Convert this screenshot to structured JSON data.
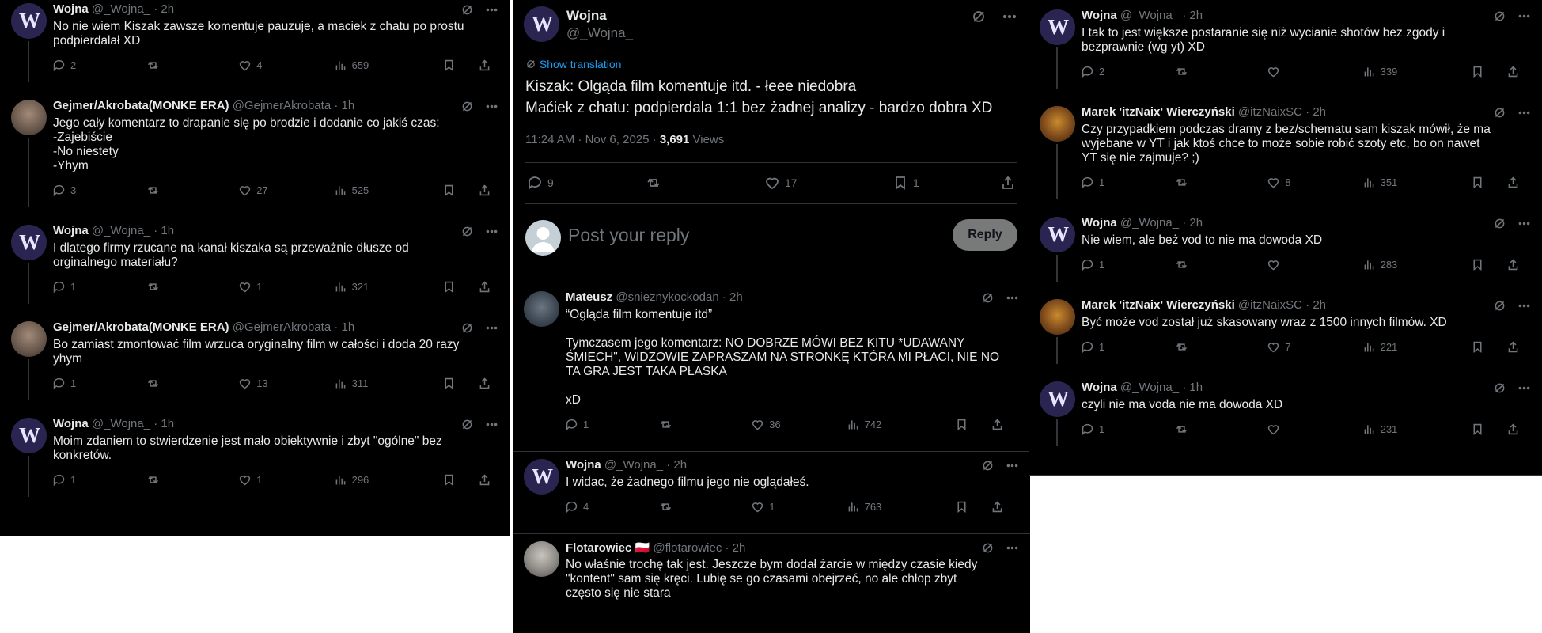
{
  "col1": {
    "tweets": [
      {
        "name": "Wojna",
        "handle": "@_Wojna_",
        "time": "2h",
        "lines": [
          "No nie wiem Kiszak zawsze komentuje pauzuje, a maciek z chatu po prostu",
          "podpierdalał XD"
        ],
        "replies": "2",
        "retweets": "",
        "likes": "4",
        "views": "659"
      },
      {
        "name": "Gejmer/Akrobata(MONKE ERA)",
        "handle": "@GejmerAkrobata",
        "time": "1h",
        "lines": [
          "Jego cały komentarz to drapanie się po brodzie i dodanie co jakiś czas:",
          "-Zajebiście",
          "-No niestety",
          "-Yhym"
        ],
        "replies": "3",
        "retweets": "",
        "likes": "27",
        "views": "525"
      },
      {
        "name": "Wojna",
        "handle": "@_Wojna_",
        "time": "1h",
        "lines": [
          "I dlatego firmy rzucane na kanał kiszaka są przeważnie dłusze od",
          "orginalnego materiału?"
        ],
        "replies": "1",
        "retweets": "",
        "likes": "1",
        "views": "321"
      },
      {
        "name": "Gejmer/Akrobata(MONKE ERA)",
        "handle": "@GejmerAkrobata",
        "time": "1h",
        "lines": [
          "Bo zamiast zmontować film wrzuca oryginalny film w całości i doda 20 razy",
          "yhym"
        ],
        "replies": "1",
        "retweets": "",
        "likes": "13",
        "views": "311"
      },
      {
        "name": "Wojna",
        "handle": "@_Wojna_",
        "time": "1h",
        "lines": [
          "Moim zdaniem to stwierdzenie jest mało obiektywnie i zbyt \"ogólne\" bez",
          "konkretów."
        ],
        "replies": "1",
        "retweets": "",
        "likes": "1",
        "views": "296"
      }
    ]
  },
  "col2": {
    "main": {
      "name": "Wojna",
      "handle": "@_Wojna_",
      "show_translation": "Show translation",
      "lines": [
        "Kiszak: Olgąda film komentuje itd. - łeee niedobra",
        "Maćiek z chatu: podpierdala 1:1 bez żadnej analizy - bardzo dobra XD"
      ],
      "timestamp": "11:24 AM · Nov 6, 2025 · ",
      "views_count": "3,691",
      "views_label": " Views",
      "replies": "9",
      "retweets": "",
      "likes": "17",
      "bookmarks": "1"
    },
    "reply_box": {
      "placeholder": "Post your reply",
      "button": "Reply"
    },
    "tweets": [
      {
        "name": "Mateusz",
        "handle": "@snieznykockodan",
        "time": "2h",
        "lines": [
          "“Ogląda film komentuje itd”",
          "",
          "Tymczasem jego komentarz: NO DOBRZE MÓWI BEZ KITU *UDAWANY",
          "ŚMIECH\", WIDZOWIE ZAPRASZAM NA STRONKĘ KTÓRA MI PŁACI, NIE NO",
          "TA GRA JEST TAKA PŁASKA",
          "",
          "xD"
        ],
        "replies": "1",
        "retweets": "",
        "likes": "36",
        "views": "742"
      },
      {
        "name": "Wojna",
        "handle": "@_Wojna_",
        "time": "2h",
        "lines": [
          "I widac, że żadnego filmu jego nie oglądałeś."
        ],
        "replies": "4",
        "retweets": "",
        "likes": "1",
        "views": "763"
      },
      {
        "name": "Flotarowiec",
        "flag": "🇵🇱",
        "handle": "@flotarowiec",
        "time": "2h",
        "lines": [
          "No właśnie trochę tak jest. Jeszcze bym dodał żarcie w między czasie kiedy",
          "\"kontent\" sam się kręci. Lubię se go czasami obejrzeć, no ale chłop zbyt",
          "często się nie stara"
        ]
      }
    ]
  },
  "col3": {
    "tweets": [
      {
        "name": "Wojna",
        "handle": "@_Wojna_",
        "time": "2h",
        "lines": [
          "I tak to jest większe postaranie się niż wycianie shotów bez zgody i",
          "bezprawnie (wg yt) XD"
        ],
        "replies": "2",
        "retweets": "",
        "likes": "",
        "views": "339"
      },
      {
        "name": "Marek 'itzNaix' Wierczyński",
        "handle": "@itzNaixSC",
        "time": "2h",
        "lines": [
          "Czy przypadkiem podczas dramy z bez/schematu sam kiszak mówił, że ma",
          "wyjebane w YT i jak ktoś chce to może sobie robić szoty etc, bo on nawet",
          "YT się nie zajmuje? ;)"
        ],
        "replies": "1",
        "retweets": "",
        "likes": "8",
        "views": "351"
      },
      {
        "name": "Wojna",
        "handle": "@_Wojna_",
        "time": "2h",
        "lines": [
          "Nie wiem, ale beż vod to nie ma dowoda XD"
        ],
        "replies": "1",
        "retweets": "",
        "likes": "",
        "views": "283"
      },
      {
        "name": "Marek 'itzNaix' Wierczyński",
        "handle": "@itzNaixSC",
        "time": "2h",
        "lines": [
          "Być może vod został już skasowany wraz z 1500 innych filmów. XD"
        ],
        "replies": "1",
        "retweets": "",
        "likes": "7",
        "views": "221"
      },
      {
        "name": "Wojna",
        "handle": "@_Wojna_",
        "time": "1h",
        "lines": [
          "czyli nie ma voda nie ma dowoda XD"
        ],
        "replies": "1",
        "retweets": "",
        "likes": "",
        "views": "231"
      }
    ]
  },
  "icons": {
    "grok": "grok-icon",
    "more": "more-icon",
    "reply": "reply-icon",
    "retweet": "retweet-icon",
    "like": "like-icon",
    "views": "views-icon",
    "bookmark": "bookmark-icon",
    "share": "share-icon"
  },
  "colors": {
    "background": "#000000",
    "text": "#e7e9ea",
    "secondary": "#71767b",
    "link": "#1d9bf0",
    "border": "#2f3336",
    "reply_button": "#787a7a"
  }
}
